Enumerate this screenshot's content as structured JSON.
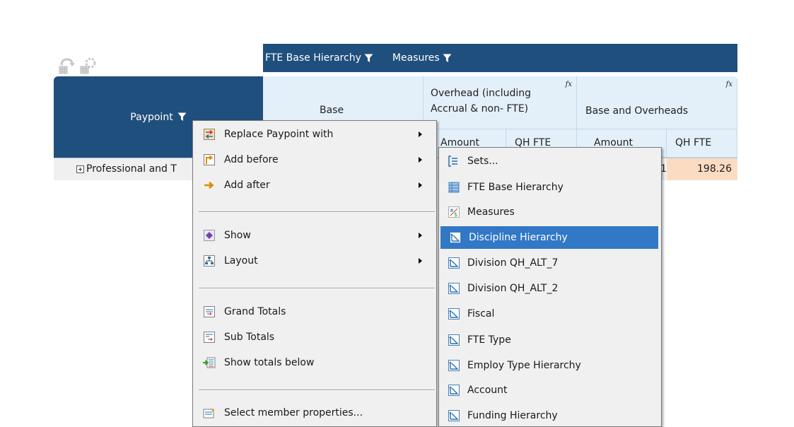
{
  "column_bar": {
    "hierarchy_1": "FTE Base Hierarchy",
    "hierarchy_2": "Measures"
  },
  "grid": {
    "row_header": "Paypoint",
    "col_base": "Base",
    "col_overhead": "Overhead  (including Accrual  & non- FTE)",
    "col_overhead_line1": "Overhead  (including",
    "col_overhead_line2": "Accrual  & non- FTE)",
    "col_base_overheads": "Base and Overheads",
    "fx_symbol": "fx",
    "sub_amount_1": "Amount",
    "sub_qhfte_1": "QH FTE",
    "sub_amount_2": "Amount",
    "sub_qhfte_2": "QH FTE",
    "row_label": "Professional and T",
    "cell_partial": "1",
    "cell_value": "198.26",
    "cell_value_bg": "#fbdcc2"
  },
  "context_menu": {
    "items": [
      {
        "label": "Replace Paypoint with",
        "icon": "replace-icon",
        "has_submenu": true
      },
      {
        "label": "Add before",
        "icon": "add-before-icon",
        "has_submenu": true
      },
      {
        "label": "Add after",
        "icon": "add-after-icon",
        "has_submenu": true
      },
      {
        "label": "Show",
        "icon": "show-icon",
        "has_submenu": true
      },
      {
        "label": "Layout",
        "icon": "layout-icon",
        "has_submenu": true
      },
      {
        "label": "Grand Totals",
        "icon": "grand-totals-icon",
        "has_submenu": false
      },
      {
        "label": "Sub Totals",
        "icon": "sub-totals-icon",
        "has_submenu": false
      },
      {
        "label": "Show totals below",
        "icon": "show-totals-below-icon",
        "has_submenu": false
      },
      {
        "label": "Select member properties...",
        "icon": "member-properties-icon",
        "has_submenu": false
      }
    ]
  },
  "submenu": {
    "selected_index": 3,
    "items": [
      {
        "label": "Sets...",
        "icon": "sets-icon"
      },
      {
        "label": "FTE Base Hierarchy",
        "icon": "hierarchy-table-icon"
      },
      {
        "label": "Measures",
        "icon": "measures-icon"
      },
      {
        "label": "Discipline Hierarchy",
        "icon": "hierarchy-icon"
      },
      {
        "label": "Division QH_ALT_7",
        "icon": "hierarchy-icon"
      },
      {
        "label": "Division QH_ALT_2",
        "icon": "hierarchy-icon"
      },
      {
        "label": "Fiscal",
        "icon": "hierarchy-icon"
      },
      {
        "label": "FTE Type",
        "icon": "hierarchy-icon"
      },
      {
        "label": "Employ Type Hierarchy",
        "icon": "hierarchy-icon"
      },
      {
        "label": "Account",
        "icon": "hierarchy-icon"
      },
      {
        "label": "Funding Hierarchy",
        "icon": "hierarchy-icon"
      }
    ]
  },
  "colors": {
    "header_blue": "#1f4f7c",
    "cell_light_blue": "#e3f0fa",
    "selection_blue": "#3178c6",
    "menu_bg": "#f0f0f0"
  }
}
